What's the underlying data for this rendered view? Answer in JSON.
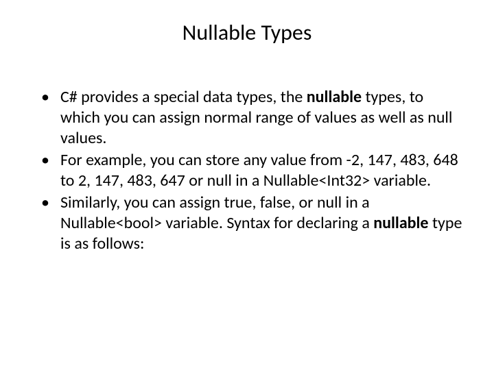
{
  "slide": {
    "title": "Nullable Types",
    "bullets": [
      {
        "parts": [
          {
            "text": "C# provides a special data types, the ",
            "bold": false
          },
          {
            "text": "nullable",
            "bold": true
          },
          {
            "text": " types, to which you can assign normal range of values as well as null values.",
            "bold": false
          }
        ]
      },
      {
        "parts": [
          {
            "text": "For example, you can store any value from -2, 147, 483, 648 to 2, 147, 483, 647 or null in a Nullable<Int32> variable.",
            "bold": false
          }
        ]
      },
      {
        "parts": [
          {
            "text": "Similarly, you can assign true, false, or null in a Nullable<bool> variable. Syntax for declaring a ",
            "bold": false
          },
          {
            "text": "nullable",
            "bold": true
          },
          {
            "text": " type is as follows:",
            "bold": false
          }
        ]
      }
    ]
  }
}
